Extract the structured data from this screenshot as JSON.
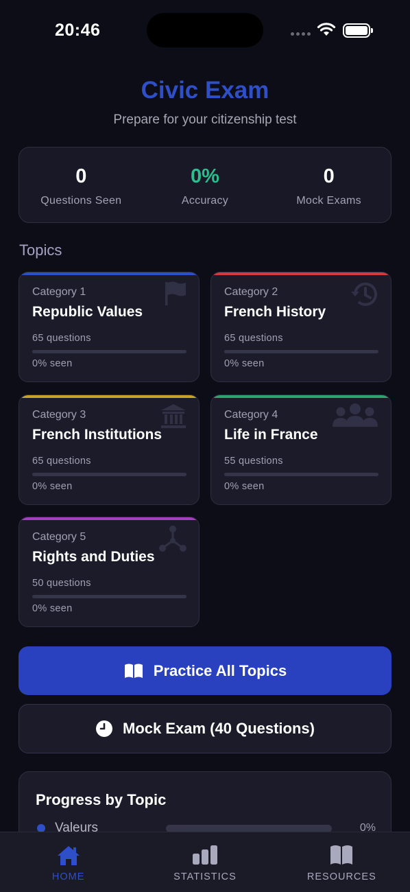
{
  "status_bar": {
    "time": "20:46"
  },
  "header": {
    "title": "Civic Exam",
    "subtitle": "Prepare for your citizenship test"
  },
  "stats": [
    {
      "value": "0",
      "label": "Questions Seen"
    },
    {
      "value": "0%",
      "label": "Accuracy"
    },
    {
      "value": "0",
      "label": "Mock Exams"
    }
  ],
  "topics_title": "Topics",
  "topics": [
    {
      "category": "Category 1",
      "name": "Republic Values",
      "questions": "65 questions",
      "seen": "0% seen",
      "seen_fraction": 0,
      "accent": "#2f4fc9",
      "icon": "flag-icon"
    },
    {
      "category": "Category 2",
      "name": "French History",
      "questions": "65 questions",
      "seen": "0% seen",
      "seen_fraction": 0,
      "accent": "#d23b3b",
      "icon": "history-icon"
    },
    {
      "category": "Category 3",
      "name": "French Institutions",
      "questions": "65 questions",
      "seen": "0% seen",
      "seen_fraction": 0,
      "accent": "#c9a227",
      "icon": "institution-icon"
    },
    {
      "category": "Category 4",
      "name": "Life in France",
      "questions": "55 questions",
      "seen": "0% seen",
      "seen_fraction": 0,
      "accent": "#2da36f",
      "icon": "people-icon"
    },
    {
      "category": "Category 5",
      "name": "Rights and Duties",
      "questions": "50 questions",
      "seen": "0% seen",
      "seen_fraction": 0,
      "accent": "#a53fbf",
      "icon": "network-icon"
    }
  ],
  "actions": {
    "practice_all": "Practice All Topics",
    "mock_exam": "Mock Exam (40 Questions)"
  },
  "progress": {
    "title": "Progress by Topic",
    "rows": [
      {
        "name": "Valeurs",
        "percent": "0%",
        "fraction": 0,
        "color": "#2f4fc9"
      }
    ]
  },
  "tabs": [
    {
      "label": "HOME",
      "icon": "home-icon",
      "active": true
    },
    {
      "label": "STATISTICS",
      "icon": "bar-chart-icon",
      "active": false
    },
    {
      "label": "RESOURCES",
      "icon": "book-icon",
      "active": false
    }
  ],
  "colors": {
    "accent": "#2f4fc9",
    "primary_button": "#2941bf",
    "accuracy": "#2bbf8e",
    "background": "#0d0d17"
  }
}
